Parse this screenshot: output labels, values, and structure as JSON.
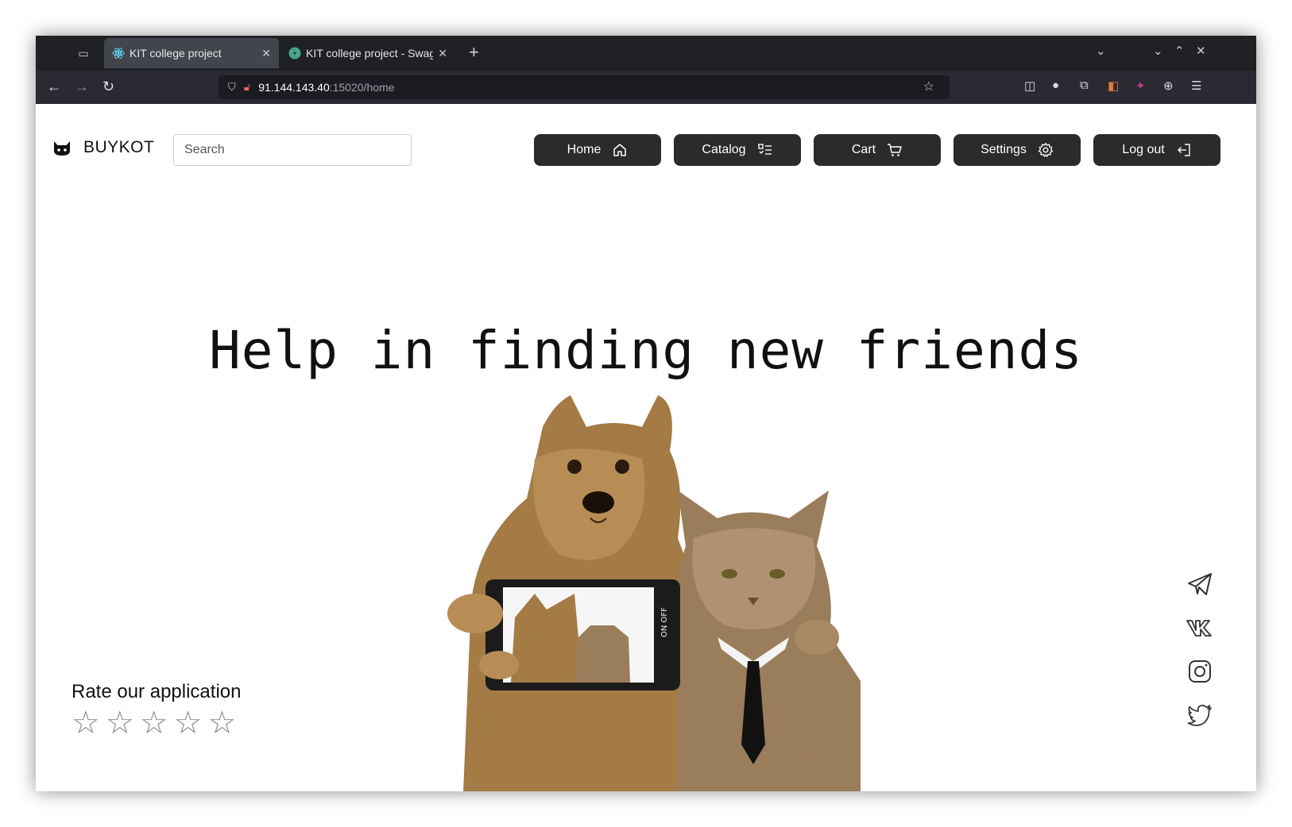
{
  "browser": {
    "tabs": [
      {
        "title": "KIT college project",
        "active": true,
        "favicon": "react-icon"
      },
      {
        "title": "KIT college project - Swagg",
        "active": false,
        "favicon": "swagger-icon"
      }
    ],
    "url_host": "91.144.143.40",
    "url_path": ":15020/home"
  },
  "header": {
    "brand": "BUYKOT",
    "search_placeholder": "Search",
    "nav": [
      {
        "label": "Home",
        "icon": "home-icon"
      },
      {
        "label": "Catalog",
        "icon": "catalog-list-icon"
      },
      {
        "label": "Cart",
        "icon": "cart-icon"
      },
      {
        "label": "Settings",
        "icon": "gear-icon"
      },
      {
        "label": "Log out",
        "icon": "logout-icon"
      }
    ]
  },
  "hero": {
    "title": "Help in finding new friends"
  },
  "rating": {
    "label": "Rate our application",
    "max_stars": 5,
    "current": 0
  },
  "social": [
    "telegram-icon",
    "vk-icon",
    "instagram-icon",
    "twitter-icon"
  ],
  "colors": {
    "button_bg": "#2a2b2c",
    "chrome_bg": "#1f2125",
    "text": "#111111"
  }
}
